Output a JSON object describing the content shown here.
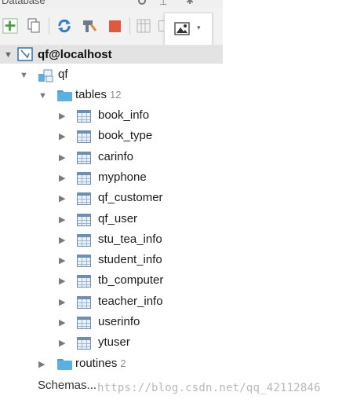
{
  "panel": {
    "title": "Database"
  },
  "connection": {
    "label": "qf@localhost"
  },
  "schema": {
    "label": "qf"
  },
  "tables_folder": {
    "label": "tables",
    "count": "12"
  },
  "tables": [
    {
      "name": "book_info"
    },
    {
      "name": "book_type"
    },
    {
      "name": "carinfo"
    },
    {
      "name": "myphone"
    },
    {
      "name": "qf_customer"
    },
    {
      "name": "qf_user"
    },
    {
      "name": "stu_tea_info"
    },
    {
      "name": "student_info"
    },
    {
      "name": "tb_computer"
    },
    {
      "name": "teacher_info"
    },
    {
      "name": "userinfo"
    },
    {
      "name": "ytuser"
    }
  ],
  "routines_folder": {
    "label": "routines",
    "count": "2"
  },
  "footer": {
    "schemas_label": "Schemas..."
  },
  "watermark": "https://blog.csdn.net/qq_42112846",
  "colors": {
    "accent_green": "#3fa63f",
    "stop_red": "#e0583e",
    "refresh_blue": "#2f7fc8",
    "folder_blue": "#5ab0e3"
  }
}
